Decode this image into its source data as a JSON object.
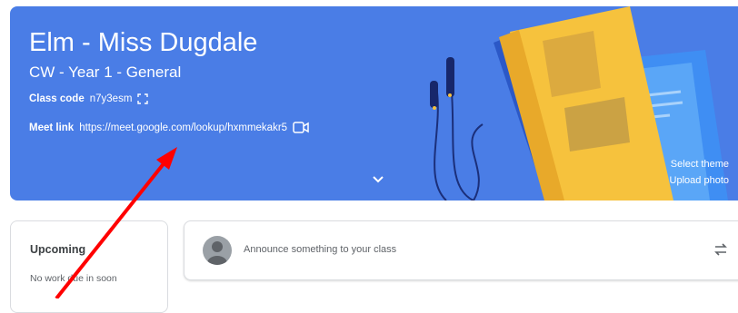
{
  "classroom": {
    "title": "Elm - Miss Dugdale",
    "subtitle": "CW - Year 1 - General",
    "class_code_label": "Class code",
    "class_code": "n7y3esm",
    "meet_link_label": "Meet link",
    "meet_link": "https://meet.google.com/lookup/hxmmekakr5",
    "select_theme": "Select theme",
    "upload_photo": "Upload photo"
  },
  "upcoming": {
    "title": "Upcoming",
    "empty_text": "No work due in soon"
  },
  "stream": {
    "announce_placeholder": "Announce something to your class"
  },
  "icons": {
    "fullscreen": "fullscreen-icon",
    "video": "video-camera-icon",
    "expand": "chevron-down-icon",
    "repost": "repost-icon",
    "avatar": "avatar-icon"
  },
  "colors": {
    "banner": "#4a7de6",
    "annotation_arrow": "#ff0000"
  }
}
